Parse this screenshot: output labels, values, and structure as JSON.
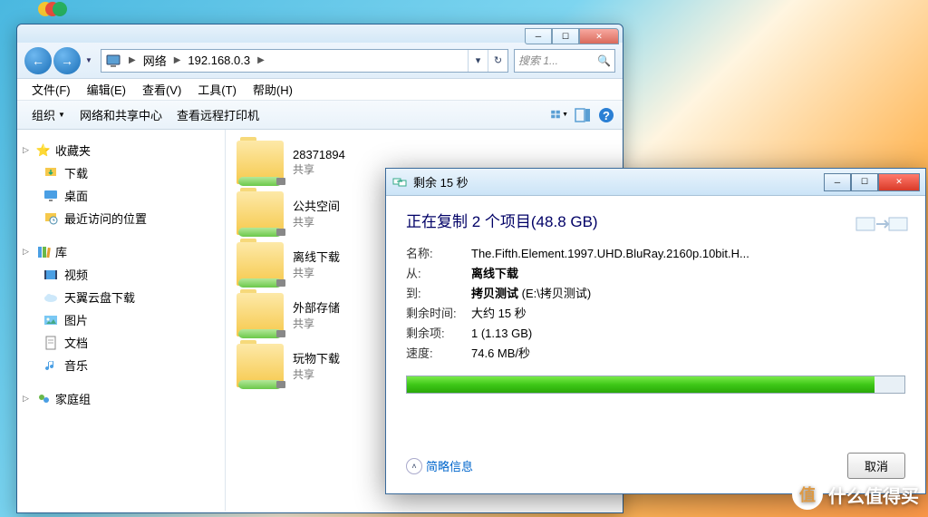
{
  "explorer": {
    "breadcrumb": {
      "root": "网络",
      "host": "192.168.0.3"
    },
    "search_placeholder": "搜索 1...",
    "menus": {
      "file": "文件(F)",
      "edit": "编辑(E)",
      "view": "查看(V)",
      "tools": "工具(T)",
      "help": "帮助(H)"
    },
    "toolbar": {
      "organize": "组织",
      "network_center": "网络和共享中心",
      "remote_printer": "查看远程打印机"
    },
    "sidebar": {
      "favorites": {
        "label": "收藏夹",
        "items": [
          "下载",
          "桌面",
          "最近访问的位置"
        ]
      },
      "libraries": {
        "label": "库",
        "items": [
          "视频",
          "天翼云盘下载",
          "图片",
          "文档",
          "音乐"
        ]
      },
      "homegroup": {
        "label": "家庭组"
      }
    },
    "folders": [
      {
        "name": "28371894",
        "sub": "共享"
      },
      {
        "name": "公共空间",
        "sub": "共享"
      },
      {
        "name": "离线下载",
        "sub": "共享"
      },
      {
        "name": "外部存储",
        "sub": "共享"
      },
      {
        "name": "玩物下载",
        "sub": "共享"
      }
    ]
  },
  "copy_dialog": {
    "title": "剩余 15 秒",
    "heading": "正在复制 2 个项目(48.8 GB)",
    "labels": {
      "name": "名称:",
      "from": "从:",
      "to": "到:",
      "time_left": "剩余时间:",
      "items_left": "剩余项:",
      "speed": "速度:"
    },
    "values": {
      "name": "The.Fifth.Element.1997.UHD.BluRay.2160p.10bit.H...",
      "from": "离线下载",
      "to": "拷贝测试 (E:\\拷贝测试)",
      "to_bold": "拷贝测试",
      "to_rest": " (E:\\拷贝测试)",
      "time_left": "大约 15 秒",
      "items_left": "1 (1.13 GB)",
      "speed": "74.6 MB/秒"
    },
    "details_link": "简略信息",
    "cancel": "取消",
    "progress_pct": 94
  },
  "watermark": "什么值得买"
}
